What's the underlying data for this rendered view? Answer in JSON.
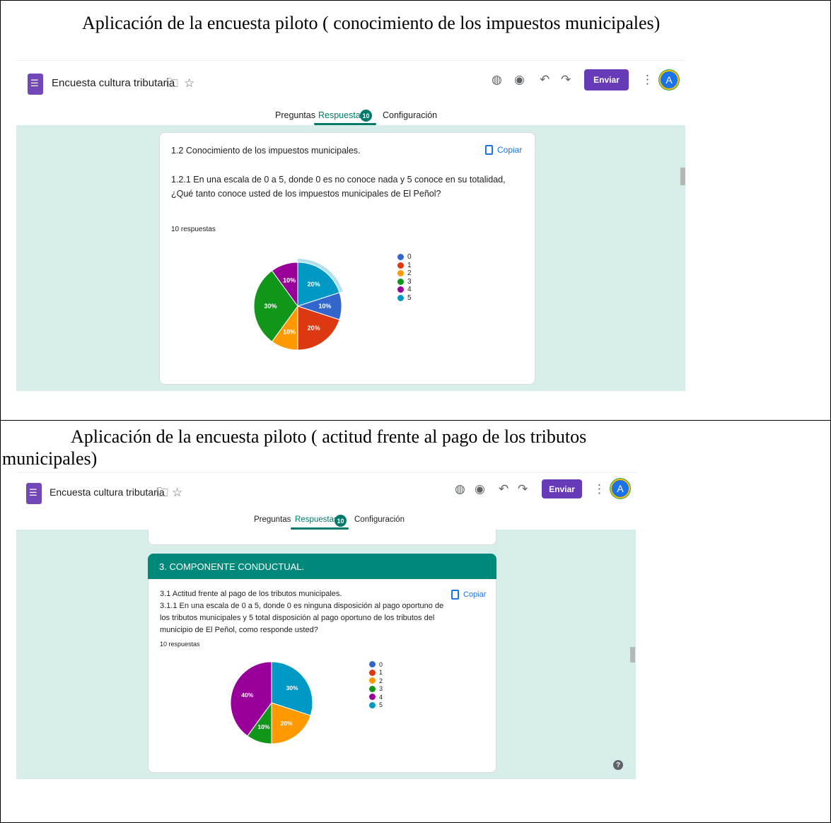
{
  "captions": {
    "first": "Aplicación de  la  encuesta piloto  ( conocimiento de  los  impuestos municipales)",
    "second_line1": "Aplicación  de la  encuesta piloto  ( actitud  frente  al pago  de los tributos",
    "second_line2": "municipales)"
  },
  "app": {
    "doc_title": "Encuesta cultura tributaria",
    "send_label": "Enviar",
    "avatar_letter": "A",
    "icons": [
      "forms-doc-icon",
      "folder-icon",
      "star-icon",
      "palette-icon",
      "preview-eye-icon",
      "undo-icon",
      "redo-icon",
      "more-vert-icon"
    ],
    "tabs": {
      "questions": "Preguntas",
      "responses": "Respuestas",
      "settings": "Configuración",
      "responses_count": "10"
    }
  },
  "colors": {
    "accent": "#673ab7",
    "teal": "#00796b",
    "canvas": "#d6ede9",
    "series": [
      "#3366cc",
      "#dc3912",
      "#ff9900",
      "#109618",
      "#990099",
      "#0099c6"
    ]
  },
  "panel1": {
    "section": "1.2  Conocimiento de los impuestos municipales.",
    "question_line1": "1.2.1  En una escala de 0 a 5, donde 0 es no conoce nada y 5 conoce en su totalidad,",
    "question_line2": "¿Qué tanto conoce usted de los impuestos municipales de El Peñol?",
    "response_count": "10 respuestas",
    "copy_label": "Copiar"
  },
  "panel2": {
    "section_header": "3.    COMPONENTE CONDUCTUAL.",
    "section": "3.1 Actitud frente al pago de los tributos municipales.",
    "question_line1": "3.1.1 En una escala de 0 a 5, donde  0 es ninguna disposición al pago oportuno de",
    "question_line2": "los tributos municipales y 5 total disposición al pago oportuno de los tributos del",
    "question_line3": "municipio de El Peñol, como responde usted?",
    "response_count": "10 respuestas",
    "copy_label": "Copiar"
  },
  "chart_data": [
    {
      "type": "pie",
      "categories": [
        "0",
        "1",
        "2",
        "3",
        "4",
        "5"
      ],
      "values": [
        10,
        20,
        10,
        30,
        10,
        20
      ],
      "labels": [
        "10%",
        "20%",
        "10%",
        "30%",
        "10%",
        "20%"
      ],
      "highlighted_category": "5",
      "legend_placement": "right"
    },
    {
      "type": "pie",
      "categories": [
        "0",
        "1",
        "2",
        "3",
        "4",
        "5"
      ],
      "values": [
        0,
        0,
        20,
        10,
        40,
        30
      ],
      "labels": [
        "",
        "",
        "20%",
        "10%",
        "40%",
        "30%"
      ],
      "legend_placement": "right"
    }
  ]
}
